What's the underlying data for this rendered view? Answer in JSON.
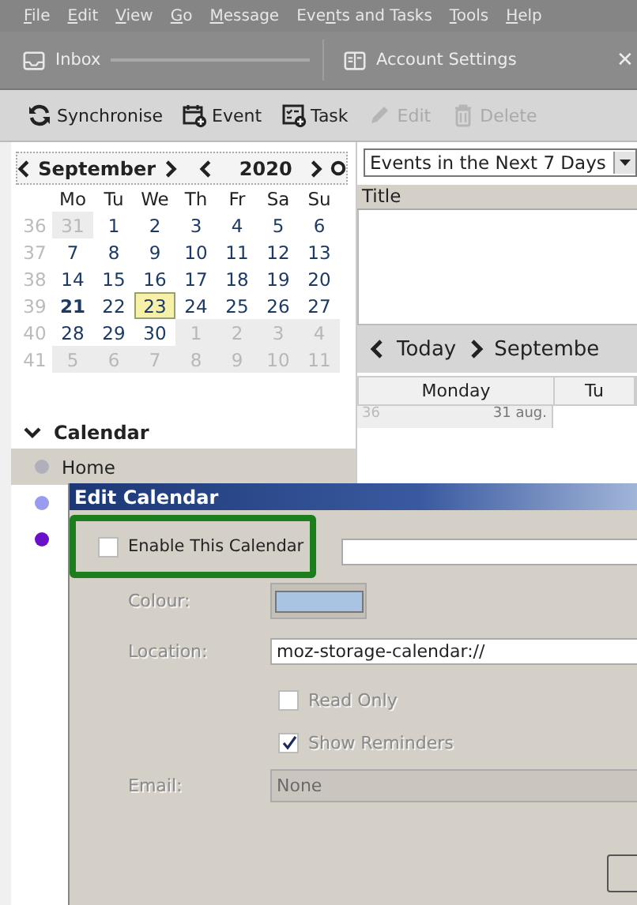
{
  "menu": [
    "File",
    "Edit",
    "View",
    "Go",
    "Message",
    "Events and Tasks",
    "Tools",
    "Help"
  ],
  "tabs": [
    {
      "label": "Inbox",
      "selected": false
    },
    {
      "label": "Account Settings",
      "selected": false
    }
  ],
  "tab_close": "✕",
  "toolbar": [
    {
      "label": "Synchronise",
      "disabled": false
    },
    {
      "label": "Event",
      "disabled": false
    },
    {
      "label": "Task",
      "disabled": false
    },
    {
      "label": "Edit",
      "disabled": true
    },
    {
      "label": "Delete",
      "disabled": true
    }
  ],
  "minicalendar": {
    "month": "September",
    "year": "2020",
    "weekdays": [
      "Mo",
      "Tu",
      "We",
      "Th",
      "Fr",
      "Sa",
      "Su"
    ],
    "weeks": [
      {
        "number": "36",
        "days": [
          {
            "d": "31",
            "outside": true,
            "today": false,
            "selected": false
          },
          {
            "d": "1",
            "outside": false,
            "today": false,
            "selected": false
          },
          {
            "d": "2",
            "outside": false,
            "today": false,
            "selected": false
          },
          {
            "d": "3",
            "outside": false,
            "today": false,
            "selected": false
          },
          {
            "d": "4",
            "outside": false,
            "today": false,
            "selected": false
          },
          {
            "d": "5",
            "outside": false,
            "today": false,
            "selected": false
          },
          {
            "d": "6",
            "outside": false,
            "today": false,
            "selected": false
          }
        ]
      },
      {
        "number": "37",
        "days": [
          {
            "d": "7",
            "outside": false,
            "today": false,
            "selected": false
          },
          {
            "d": "8",
            "outside": false,
            "today": false,
            "selected": false
          },
          {
            "d": "9",
            "outside": false,
            "today": false,
            "selected": false
          },
          {
            "d": "10",
            "outside": false,
            "today": false,
            "selected": false
          },
          {
            "d": "11",
            "outside": false,
            "today": false,
            "selected": false
          },
          {
            "d": "12",
            "outside": false,
            "today": false,
            "selected": false
          },
          {
            "d": "13",
            "outside": false,
            "today": false,
            "selected": false
          }
        ]
      },
      {
        "number": "38",
        "days": [
          {
            "d": "14",
            "outside": false,
            "today": false,
            "selected": false
          },
          {
            "d": "15",
            "outside": false,
            "today": false,
            "selected": false
          },
          {
            "d": "16",
            "outside": false,
            "today": false,
            "selected": false
          },
          {
            "d": "17",
            "outside": false,
            "today": false,
            "selected": false
          },
          {
            "d": "18",
            "outside": false,
            "today": false,
            "selected": false
          },
          {
            "d": "19",
            "outside": false,
            "today": false,
            "selected": false
          },
          {
            "d": "20",
            "outside": false,
            "today": false,
            "selected": false
          }
        ]
      },
      {
        "number": "39",
        "days": [
          {
            "d": "21",
            "outside": false,
            "today": true,
            "selected": false
          },
          {
            "d": "22",
            "outside": false,
            "today": false,
            "selected": false
          },
          {
            "d": "23",
            "outside": false,
            "today": false,
            "selected": true
          },
          {
            "d": "24",
            "outside": false,
            "today": false,
            "selected": false
          },
          {
            "d": "25",
            "outside": false,
            "today": false,
            "selected": false
          },
          {
            "d": "26",
            "outside": false,
            "today": false,
            "selected": false
          },
          {
            "d": "27",
            "outside": false,
            "today": false,
            "selected": false
          }
        ]
      },
      {
        "number": "40",
        "days": [
          {
            "d": "28",
            "outside": false,
            "today": false,
            "selected": false
          },
          {
            "d": "29",
            "outside": false,
            "today": false,
            "selected": false
          },
          {
            "d": "30",
            "outside": false,
            "today": false,
            "selected": false
          },
          {
            "d": "1",
            "outside": true,
            "today": false,
            "selected": false
          },
          {
            "d": "2",
            "outside": true,
            "today": false,
            "selected": false
          },
          {
            "d": "3",
            "outside": true,
            "today": false,
            "selected": false
          },
          {
            "d": "4",
            "outside": true,
            "today": false,
            "selected": false
          }
        ]
      },
      {
        "number": "41",
        "days": [
          {
            "d": "5",
            "outside": true,
            "today": false,
            "selected": false
          },
          {
            "d": "6",
            "outside": true,
            "today": false,
            "selected": false
          },
          {
            "d": "7",
            "outside": true,
            "today": false,
            "selected": false
          },
          {
            "d": "8",
            "outside": true,
            "today": false,
            "selected": false
          },
          {
            "d": "9",
            "outside": true,
            "today": false,
            "selected": false
          },
          {
            "d": "10",
            "outside": true,
            "today": false,
            "selected": false
          },
          {
            "d": "11",
            "outside": true,
            "today": false,
            "selected": false
          }
        ]
      }
    ]
  },
  "calendar_list": {
    "heading": "Calendar",
    "expanded": true,
    "items": [
      {
        "name": "Home",
        "color": "#b0b0bc",
        "selected": true
      },
      {
        "color": "#9a9af0",
        "selected": false
      },
      {
        "color": "#6a10c8",
        "selected": false
      }
    ]
  },
  "events_filter": "Events in the Next 7 Days",
  "events_columns": [
    "Title"
  ],
  "day_nav": {
    "today": "Today",
    "label": "Septembe"
  },
  "week_view": {
    "columns": [
      "Monday",
      "Tu"
    ],
    "week_number": "36",
    "first_date": "31 aug."
  },
  "dialog": {
    "title": "Edit Calendar",
    "enable": {
      "label": "Enable This Calendar",
      "checked": false
    },
    "rows": [
      {
        "kind": "blank"
      },
      {
        "kind": "color",
        "label": "Colour:",
        "color": "#a9c4e2",
        "disabled": true
      },
      {
        "kind": "text",
        "label": "Location:",
        "value": "moz-storage-calendar://",
        "disabled": true
      },
      {
        "kind": "checkbox",
        "label": "Read Only",
        "checked": false,
        "disabled": true
      },
      {
        "kind": "checkbox",
        "label": "Show Reminders",
        "checked": true,
        "disabled": true
      },
      {
        "kind": "select",
        "label": "Email:",
        "value": "None",
        "disabled": true
      }
    ]
  }
}
